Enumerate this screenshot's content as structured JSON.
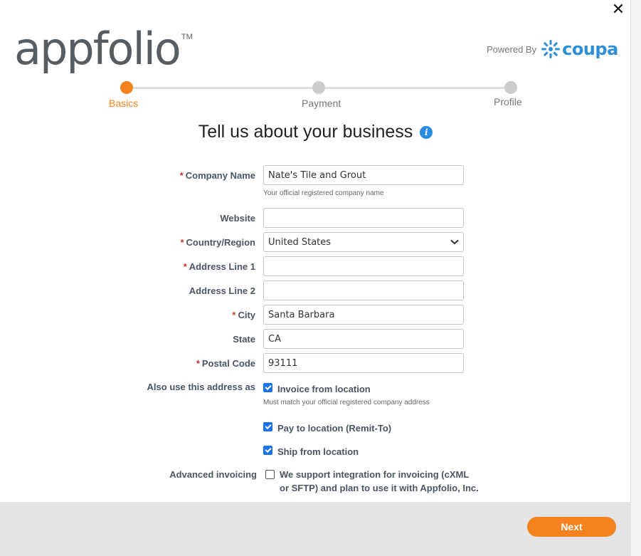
{
  "header": {
    "close_glyph": "✕",
    "logo_text": "appfolio",
    "logo_tm": "TM",
    "powered_label": "Powered By",
    "coupa_text": "coupa"
  },
  "steps": [
    {
      "label": "Basics",
      "state": "active",
      "color": "#f4821f"
    },
    {
      "label": "Payment",
      "state": "pending",
      "color": "#cccccc"
    },
    {
      "label": "Profile",
      "state": "pending",
      "color": "#cccccc"
    }
  ],
  "title": "Tell us about your business",
  "info_glyph": "i",
  "form": {
    "company_name": {
      "label": "Company Name",
      "value": "Nate's Tile and Grout",
      "hint": "Your official registered company name"
    },
    "website": {
      "label": "Website",
      "value": ""
    },
    "country": {
      "label": "Country/Region",
      "value": "United States"
    },
    "address1": {
      "label": "Address Line 1",
      "value": ""
    },
    "address2": {
      "label": "Address Line 2",
      "value": ""
    },
    "city": {
      "label": "City",
      "value": "Santa Barbara"
    },
    "state": {
      "label": "State",
      "value": "CA"
    },
    "postal": {
      "label": "Postal Code",
      "value": "93111"
    },
    "also_use_label": "Also use this address as",
    "invoice_from": {
      "label": "Invoice from location",
      "checked": true,
      "hint": "Must match your official registered company address"
    },
    "pay_to": {
      "label": "Pay to location (Remit-To)",
      "checked": true
    },
    "ship_from": {
      "label": "Ship from location",
      "checked": true
    },
    "advanced_label": "Advanced invoicing",
    "advanced": {
      "label": "We support integration for invoicing (cXML or SFTP) and plan to use it with Appfolio, Inc.",
      "checked": false
    }
  },
  "required_mark": "*",
  "footer": {
    "next_label": "Next"
  },
  "colors": {
    "accent": "#f4821f",
    "link_blue": "#2b8be0",
    "coupa_blue": "#2f8fd6"
  }
}
